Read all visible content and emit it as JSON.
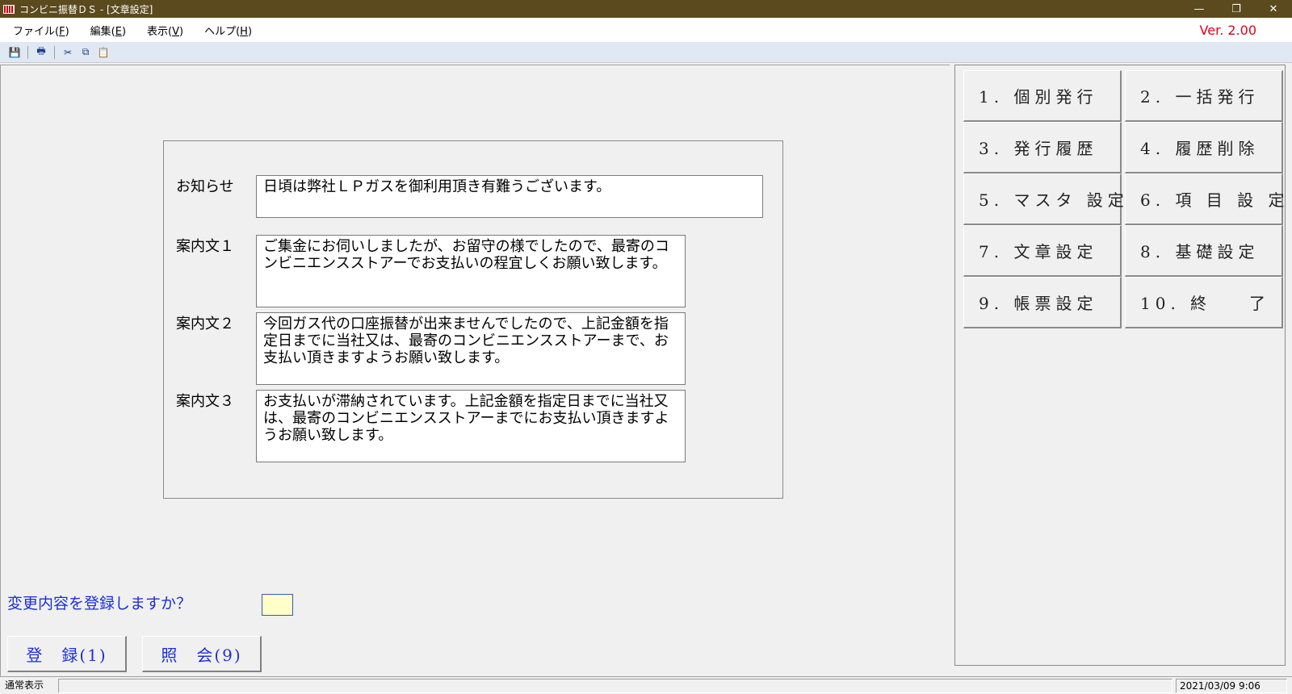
{
  "window": {
    "title": "コンビニ振替ＤＳ - [文章設定]",
    "min": "—",
    "restore": "❐",
    "close": "✕"
  },
  "menu": {
    "file_label": "ファイル(",
    "file_key": "F",
    "edit_label": "編集(",
    "edit_key": "E",
    "view_label": "表示(",
    "view_key": "V",
    "help_label": "ヘルプ(",
    "help_key": "H",
    "close_paren": ")",
    "version": "Ver. 2.00"
  },
  "toolbar": {
    "icons": [
      "save-icon",
      "print-icon",
      "cut-icon",
      "copy-icon",
      "paste-icon"
    ],
    "save": "💾",
    "print": "🖶",
    "cut": "✂",
    "copy": "⧉",
    "paste": "📋"
  },
  "form": {
    "notice_label": "お知らせ",
    "notice_text": "日頃は弊社ＬＰガスを御利用頂き有難うございます。",
    "guide1_label": "案内文１",
    "guide1_text": "ご集金にお伺いしましたが、お留守の様でしたので、最寄のコンビニエンスストアーでお支払いの程宜しくお願い致します。",
    "guide2_label": "案内文２",
    "guide2_text": "今回ガス代の口座振替が出来ませんでしたので、上記金額を指定日までに当社又は、最寄のコンビニエンスストアーまで、お支払い頂きますようお願い致します。",
    "guide3_label": "案内文３",
    "guide3_text": "お支払いが滞納されています。上記金額を指定日までに当社又は、最寄のコンビニエンスストアーまでにお支払い頂きますようお願い致します。"
  },
  "confirm": {
    "prompt": "変更内容を登録しますか？",
    "input_value": "",
    "register_button": "登　録(1)",
    "inquiry_button": "照　会(9)"
  },
  "side_menu": {
    "btn1": "1. 個別発行",
    "btn2": "2. 一括発行",
    "btn3": "3. 発行履歴",
    "btn4": "4. 履歴削除",
    "btn5": "5. マスタ 設定",
    "btn6": "6. 項 目 設 定",
    "btn7": "7. 文章設定",
    "btn8": "8. 基礎設定",
    "btn9": "9. 帳票設定",
    "btn10_num": "10. 終",
    "btn10_end": "了"
  },
  "status": {
    "mode": "通常表示",
    "message": "",
    "datetime": "2021/03/09 9:06"
  },
  "colors": {
    "titlebar": "#5a4a1e",
    "version": "#e0001a",
    "prompt": "#1c2fd6",
    "input_bg": "#ffffc8"
  }
}
